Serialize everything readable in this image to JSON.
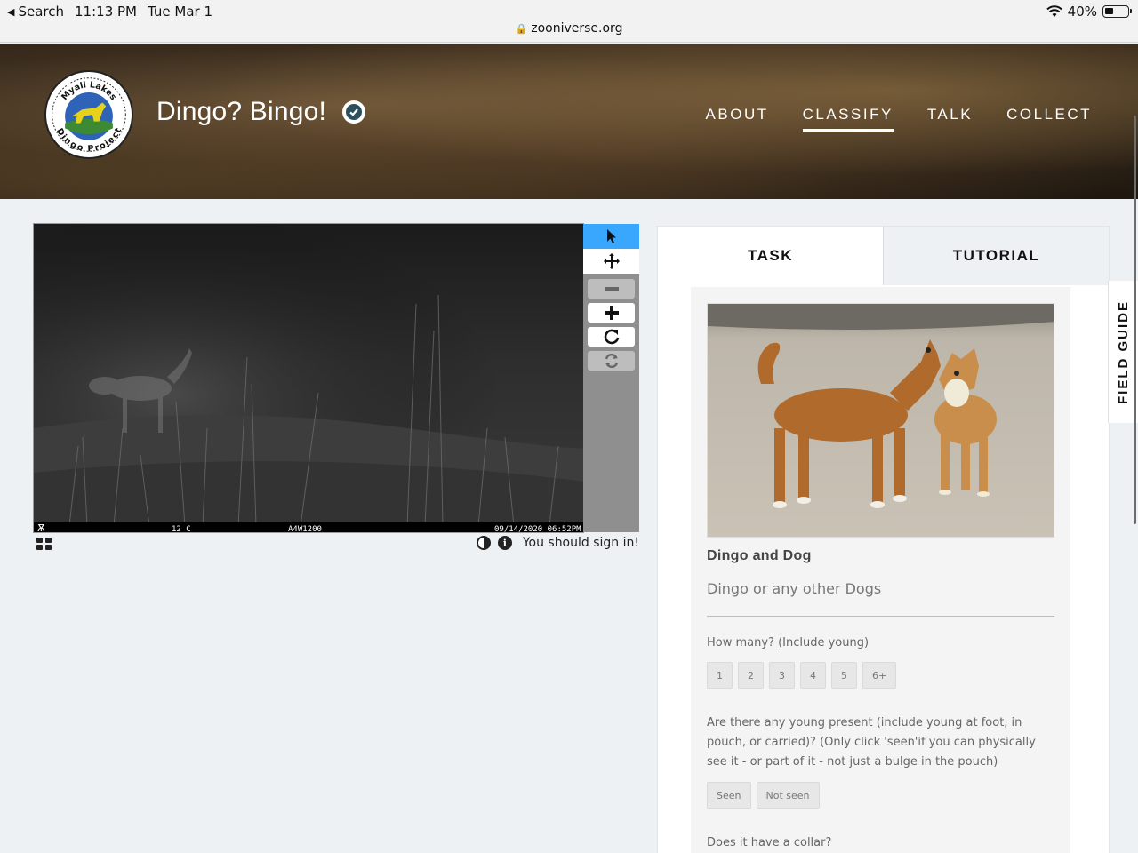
{
  "status_bar": {
    "back_label": "Search",
    "time": "11:13 PM",
    "date": "Tue Mar 1",
    "battery": "40%",
    "url": "zooniverse.org",
    "wifi_icon": "wifi-icon",
    "battery_icon": "battery-icon"
  },
  "header": {
    "logo_text_top": "Myall Lakes",
    "logo_text_bottom": "Dingo Project",
    "title": "Dingo? Bingo!",
    "nav": [
      "ABOUT",
      "CLASSIFY",
      "TALK",
      "COLLECT"
    ],
    "active_nav": "CLASSIFY"
  },
  "viewer": {
    "camera_overlay": {
      "temperature": "12 C",
      "camera_id": "A4W1200",
      "timestamp": "09/14/2020 06:52PM"
    },
    "tools": [
      "pointer-icon",
      "move-icon",
      "zoom-out-icon",
      "zoom-in-icon",
      "rotate-icon",
      "reset-icon"
    ],
    "sign_in_message": "You should sign in!"
  },
  "task_panel": {
    "tabs": [
      "TASK",
      "TUTORIAL"
    ],
    "active_tab": "TASK",
    "choice_title": "Dingo and Dog",
    "choice_subtitle": "Dingo or any other Dogs",
    "questions": [
      {
        "label": "How many? (Include young)",
        "answers": [
          "1",
          "2",
          "3",
          "4",
          "5",
          "6+"
        ]
      },
      {
        "label": "Are there any young present (include young at foot, in pouch, or carried)? (Only click 'seen'if you can physically see it - or part of it - not just a bulge in the pouch)",
        "answers": [
          "Seen",
          "Not seen"
        ]
      },
      {
        "label": "Does it have a collar?",
        "answers": []
      }
    ],
    "field_guide_label": "FIELD GUIDE"
  }
}
